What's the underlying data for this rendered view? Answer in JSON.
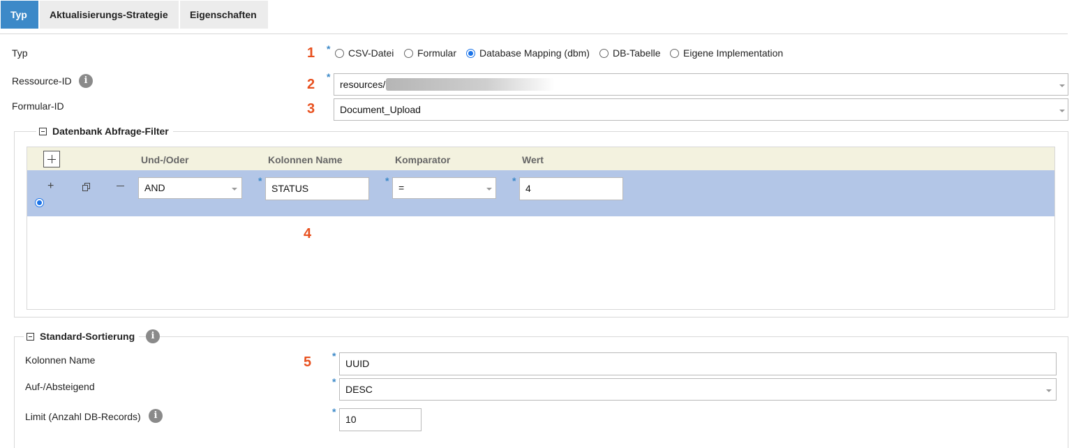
{
  "tabs": [
    {
      "label": "Typ",
      "active": true
    },
    {
      "label": "Aktualisierungs-Strategie",
      "active": false
    },
    {
      "label": "Eigenschaften",
      "active": false
    }
  ],
  "markers": [
    "1",
    "2",
    "3",
    "4",
    "5"
  ],
  "required_mark": "*",
  "typ": {
    "label": "Typ",
    "options": [
      "CSV-Datei",
      "Formular",
      "Database Mapping (dbm)",
      "DB-Tabelle",
      "Eigene Implementation"
    ],
    "selected": "Database Mapping (dbm)"
  },
  "ressource": {
    "label": "Ressource-ID",
    "value": "resources/"
  },
  "formular": {
    "label": "Formular-ID",
    "value": "Document_Upload"
  },
  "filter": {
    "title": "Datenbank Abfrage-Filter",
    "columns": [
      "Und-/Oder",
      "Kolonnen Name",
      "Komparator",
      "Wert"
    ],
    "rows": [
      {
        "und_oder": "AND",
        "kolonne": "STATUS",
        "komparator": "=",
        "wert": "4",
        "selected": true
      }
    ]
  },
  "sortierung": {
    "title": "Standard-Sortierung",
    "kolonnen_label": "Kolonnen Name",
    "kolonnen_value": "UUID",
    "auf_ab_label": "Auf-/Absteigend",
    "auf_ab_value": "DESC",
    "limit_label": "Limit (Anzahl DB-Records)",
    "limit_value": "10"
  },
  "icons": {
    "info": "info-icon",
    "collapse": "collapse-icon",
    "add": "plus-icon",
    "copy": "copy-icon",
    "remove": "minus-icon"
  },
  "colors": {
    "accent": "#3c89c8",
    "marker": "#e8501e",
    "row_selected": "#b3c6e7",
    "grid_header": "#f3f2df"
  }
}
